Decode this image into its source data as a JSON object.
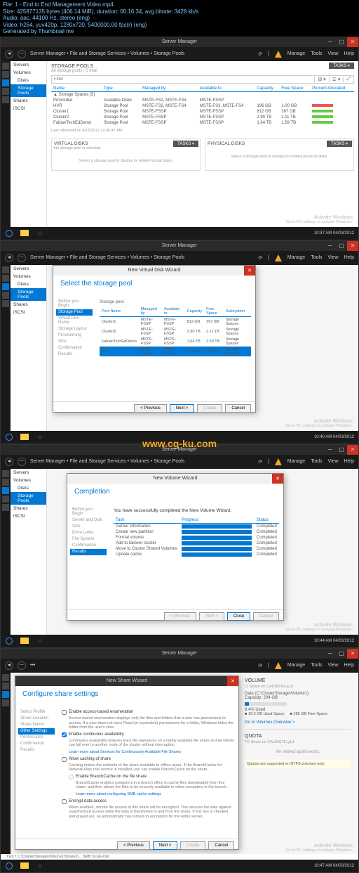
{
  "meta": {
    "l1": "File: 1 - End to End Management Video.mp4",
    "l2": "Size: 425877135 bytes (406.14 MiB), duration: 00:16:34, avg.bitrate: 3428 kb/s",
    "l3": "Audio: aac, 44100 Hz, stereo (eng)",
    "l4": "Video: h264, yuv420p, 1280x720, 5400000.00 fps(r) (eng)",
    "l5": "Generated by Thumbnail me"
  },
  "header": {
    "app": "Server Manager",
    "crumb": "Server Manager • File and Storage Services • Volumes • Storage Pools",
    "menu": [
      "Manage",
      "Tools",
      "View",
      "Help"
    ]
  },
  "sidebar": {
    "items": [
      "Servers",
      "Volumes",
      "Disks",
      "Storage Pools",
      "Shares",
      "iSCSI"
    ],
    "selected": 3
  },
  "s1": {
    "title": "STORAGE POOLS",
    "sub": "All storage pools | 5 total",
    "tasks": "TASKS ▾",
    "filter": "Filter",
    "cols": [
      "Name",
      "Type",
      "Managed by",
      "Available to",
      "Capacity",
      "Free Space",
      "Percent Allocated"
    ],
    "group": "▲ Storage Spaces (5)",
    "rows": [
      {
        "n": "Primordial",
        "t": "Available Disks",
        "m": "MSTE-FS2, MSTE-FS4",
        "a": "MSTE-FSSP",
        "c": "",
        "f": "",
        "b": ""
      },
      {
        "n": "HVR",
        "t": "Storage Pool",
        "m": "MSTE-FS2, MSTE-FS4",
        "a": "MSTE-FS3, MSTE-FS4",
        "c": "196 GB",
        "f": "1.00 GB",
        "b": "r"
      },
      {
        "n": "Cluster1",
        "t": "Storage Pool",
        "m": "MSTE-FSSP",
        "a": "MSTE-FSSP",
        "c": "812 GB",
        "f": "397 GB",
        "b": "g"
      },
      {
        "n": "Cluster2",
        "t": "Storage Pool",
        "m": "MSTE-FSSP",
        "a": "MSTE-FSSP",
        "c": "2.90 TB",
        "f": "2.11 TB",
        "b": "g"
      },
      {
        "n": "FabianTechEdDemo",
        "t": "Storage Pool",
        "m": "MSTE-FSSP",
        "a": "MSTE-FSSP",
        "c": "1.64 TB",
        "f": "1.59 TB",
        "b": "g"
      }
    ],
    "refresh": "Last refreshed on 4/13/2012 10:36:47 AM",
    "vd": {
      "title": "VIRTUAL DISKS",
      "sub": "No storage pool is selected.",
      "msg": "Select a storage pool to display its related virtual disks."
    },
    "pd": {
      "title": "PHYSICAL DISKS",
      "msg": "Select a storage pool to display its related physical disks."
    },
    "clock": "10:37 AM\n04/03/2012"
  },
  "s2": {
    "dialog_title": "New Virtual Disk Wizard",
    "heading": "Select the storage pool",
    "steps": [
      "Before you Begin",
      "Storage Pool",
      "Virtual Disk Name",
      "Storage Layout",
      "Provisioning",
      "Size",
      "Confirmation",
      "Results"
    ],
    "sel_step": 1,
    "cols": [
      "Pool Name",
      "Managed by",
      "Available to",
      "Capacity",
      "Free Space",
      "Subsystem"
    ],
    "rows": [
      {
        "n": "Cluster1",
        "m": "MSTE-FSSP",
        "a": "MSTE-FSSP",
        "c": "812 GB",
        "f": "397 GB",
        "s": "Storage Spaces"
      },
      {
        "n": "Cluster2",
        "m": "MSTE-FSSP",
        "a": "MSTE-FSSP",
        "c": "2.90 TB",
        "f": "2.11 TB",
        "s": "Storage Spaces"
      },
      {
        "n": "FabianTechEdDemo",
        "m": "MSTE-FSSP",
        "a": "MSTE-FSSP",
        "c": "1.64 TB",
        "f": "1.59 TB",
        "s": "Storage Spaces"
      },
      {
        "n": "Pool",
        "m": "MSTE-FSSP",
        "a": "MSTE-FSSP",
        "c": "694 GB",
        "f": "693 GB",
        "s": "Storage Spaces",
        "sel": true
      }
    ],
    "btns": {
      "prev": "< Previous",
      "next": "Next >",
      "create": "Create",
      "cancel": "Cancel"
    },
    "clock": "10:40 AM\n04/03/2012",
    "wm": "www.cg-ku.com"
  },
  "s3": {
    "dialog_title": "New Volume Wizard",
    "heading": "Completion",
    "steps": [
      "Before you Begin",
      "Server and Disk",
      "Size",
      "Drive Letter",
      "File System",
      "Confirmation",
      "Results"
    ],
    "sel_step": 6,
    "msg": "You have successfully completed the New Volume Wizard.",
    "cols": [
      "Task",
      "Progress",
      "Status"
    ],
    "rows": [
      {
        "t": "Gather information",
        "s": "Completed"
      },
      {
        "t": "Create new partition",
        "s": "Completed"
      },
      {
        "t": "Format volume",
        "s": "Completed"
      },
      {
        "t": "Add to failover cluster",
        "s": "Completed"
      },
      {
        "t": "Move to Cluster Shared Volumes",
        "s": "Completed"
      },
      {
        "t": "Update cache",
        "s": "Completed"
      }
    ],
    "btns": {
      "prev": "< Previous",
      "next": "Next >",
      "close": "Close",
      "cancel": "Cancel"
    },
    "clock": "10:44 AM\n04/03/2012"
  },
  "s4": {
    "dialog_title": "New Share Wizard",
    "heading": "Configure share settings",
    "steps": [
      "Select Profile",
      "Share Location",
      "Share Name",
      "Other Settings",
      "Permissions",
      "Confirmation",
      "Results"
    ],
    "sel_step": 3,
    "chk": [
      {
        "l": "Enable access-based enumeration",
        "c": false,
        "d": "Access-based enumeration displays only the files and folders that a user has permissions to access. If a user does not have Read (or equivalent) permissions for a folder, Windows hides the folder from the user's view."
      },
      {
        "l": "Enable continuous availability",
        "c": true,
        "d": "Continuous availability features track file operations on a highly available file share so that clients can fail over to another node of the cluster without interruption.",
        "link": "Learn more about Services for Continuously Available File Shares"
      },
      {
        "l": "Allow caching of share",
        "c": false,
        "d": "Caching makes the contents of the share available to offline users. If the BranchCache for Network Files role service is installed, you can enable BranchCache on the share."
      },
      {
        "l": "Enable BranchCache on the file share",
        "c": false,
        "d": "BranchCache enables computers in a branch office to cache files downloaded from this share, and then allows the files to be securely available to other computers in the branch.",
        "link": "Learn more about configuring SMB cache settings",
        "indent": true
      },
      {
        "l": "Encrypt data access",
        "c": false,
        "d": "When enabled, remote file access to this share will be encrypted. This secures the data against unauthorized access while the data is transferred to and from the share. If this box is checked and grayed out, an administrator has turned on encryption for the entire server."
      }
    ],
    "btns": {
      "prev": "< Previous",
      "next": "Next >",
      "create": "Create",
      "cancel": "Cancel"
    },
    "vol": {
      "title": "VOLUME",
      "sub": "D: Share on CAUMSTE-g1d",
      "path": "Data (C:\\ClusterStorage\\Volume1)",
      "cap_l": "Capacity:",
      "cap": "204 GB",
      "used_pct": "9.4% Used",
      "used": "19.3 GB Used Space",
      "free": "185 GB Free Space",
      "link": "Go to Volumes Overview >"
    },
    "quota": {
      "title": "QUOTA",
      "sub": "TE Share on CAUMSTE-g1d",
      "msg": "No related quota exists.",
      "note": "Quotas are supported on NTFS volumes only."
    },
    "footer": "TEST     C:\\ClusterStorage\\Volume1\\Shares\\...   SMB   Scale-Out",
    "clock": "10:47 AM\n04/03/2012"
  },
  "activate": {
    "l1": "Activate Windows",
    "l2": "Go to PC settings to activate Windows."
  }
}
